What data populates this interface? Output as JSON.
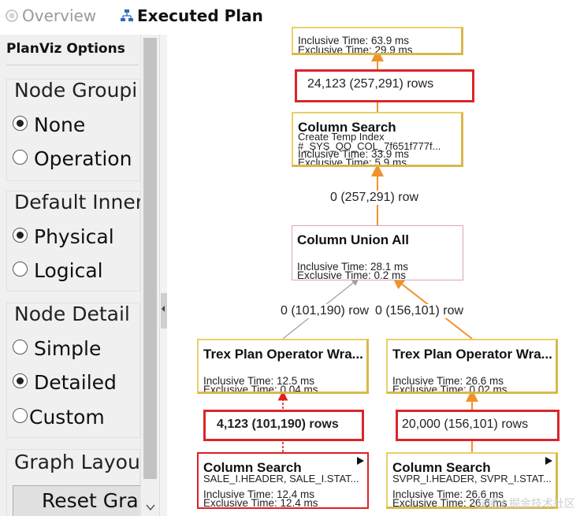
{
  "tabs": {
    "overview": "Overview",
    "executed_plan": "Executed Plan"
  },
  "sidebar": {
    "title": "PlanViz Options",
    "node_grouping": {
      "title": "Node Groupi",
      "options": [
        "None",
        "Operation"
      ],
      "selected": "None"
    },
    "default_inner": {
      "title": "Default Inner",
      "options": [
        "Physical",
        "Logical"
      ],
      "selected": "Physical"
    },
    "node_detail": {
      "title": "Node Detail",
      "options": [
        "Simple",
        "Detailed",
        "Custom"
      ],
      "selected": "Detailed"
    },
    "graph_layout": {
      "title": "Graph Layout",
      "reset_label": "Reset Grap"
    }
  },
  "graph": {
    "nodes": {
      "top": {
        "inclusive": "Inclusive Time: 63.9 ms",
        "exclusive": "Exclusive Time: 29.9 ms"
      },
      "column_search_temp": {
        "title": "Column Search",
        "line1": "Create Temp Index",
        "line2": "#_SYS_QO_COL_7f651f777f...",
        "inclusive": "Inclusive Time: 33.9 ms",
        "exclusive": "Exclusive Time: 5.9 ms"
      },
      "union_all": {
        "title": "Column Union All",
        "inclusive": "Inclusive Time: 28.1 ms",
        "exclusive": "Exclusive Time: 0.2 ms"
      },
      "trex_left": {
        "title": "Trex Plan Operator Wra...",
        "inclusive": "Inclusive Time: 12.5 ms",
        "exclusive": "Exclusive Time: 0.04 ms"
      },
      "trex_right": {
        "title": "Trex Plan Operator Wra...",
        "inclusive": "Inclusive Time: 26.6 ms",
        "exclusive": "Exclusive Time: 0.02 ms"
      },
      "cs_left": {
        "title": "Column Search",
        "line1": "SALE_I.HEADER, SALE_I.STAT...",
        "inclusive": "Inclusive Time: 12.4 ms",
        "exclusive": "Exclusive Time: 12.4 ms"
      },
      "cs_right": {
        "title": "Column Search",
        "line1": "SVPR_I.HEADER, SVPR_I.STAT...",
        "inclusive": "Inclusive Time: 26.6 ms",
        "exclusive": "Exclusive Time: 26.6 ms"
      }
    },
    "edges": {
      "e1": "24,123 (257,291) rows",
      "e2": "0 (257,291) row",
      "e3a": "0 (101,190) row",
      "e3b": "0 (156,101) row",
      "e4": "4,123 (101,190) rows",
      "e5": "20,000 (156,101) rows"
    }
  },
  "watermark": "@稀土掘金技术社区",
  "colors": {
    "highlight": "#d9262a",
    "edge_orange": "#f0922b",
    "edge_gray": "#9e9e9e",
    "edge_red": "#e02020",
    "node_yellow": "#e9cf6b"
  }
}
